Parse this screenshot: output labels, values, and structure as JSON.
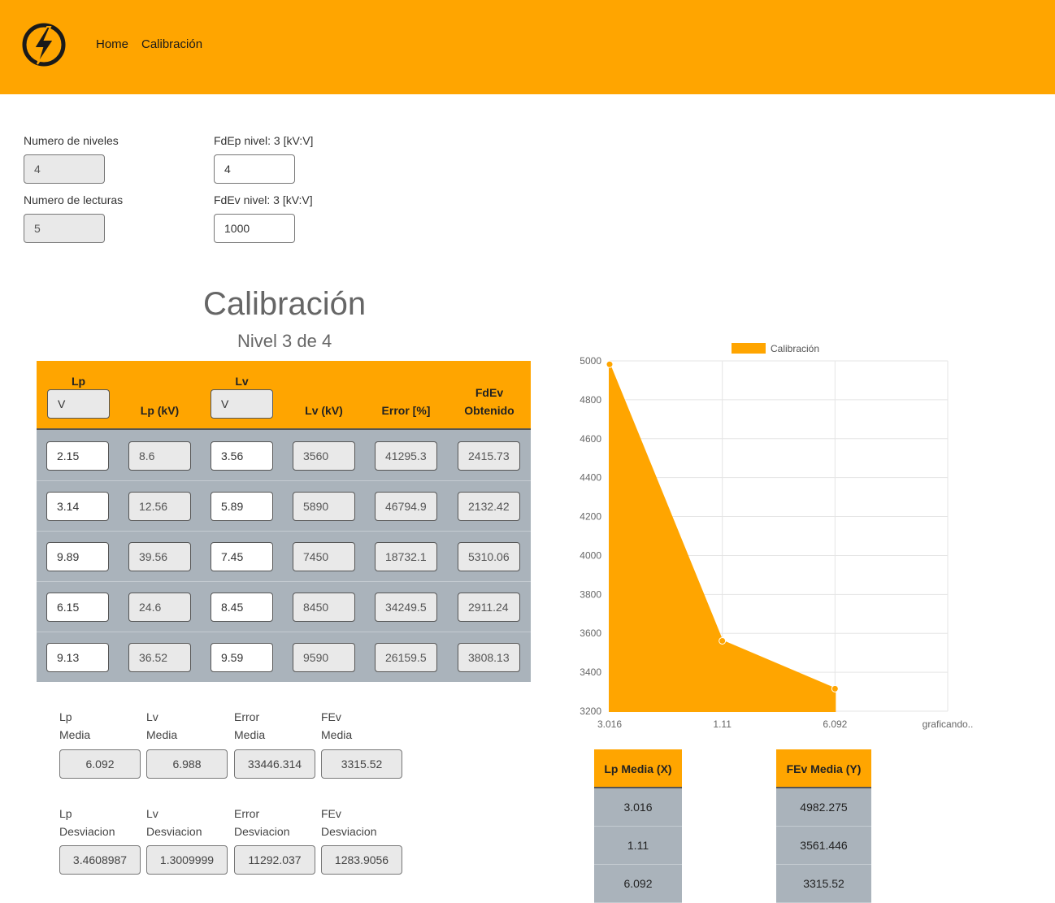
{
  "nav": {
    "home": "Home",
    "calibracion": "Calibración",
    "logo_icon": "lightning-bolt-icon"
  },
  "form": {
    "niveles_label": "Numero de niveles",
    "niveles_value": "4",
    "lecturas_label": "Numero de lecturas",
    "lecturas_value": "5",
    "fdep_label": "FdEp nivel: 3 [kV:V]",
    "fdep_value": "4",
    "fdev_label": "FdEv nivel: 3 [kV:V]",
    "fdev_value": "1000"
  },
  "section": {
    "title": "Calibración",
    "subtitle": "Nivel 3 de 4"
  },
  "table": {
    "headers": {
      "lp": "Lp",
      "lp_kv": "Lp (kV)",
      "lv": "Lv",
      "lv_kv": "Lv (kV)",
      "error": "Error [%]",
      "fdev_line1": "FdEv",
      "fdev_line2": "Obtenido"
    },
    "lp_input_value": "V",
    "lv_input_value": "V",
    "rows": [
      {
        "lp": "2.15",
        "lp_kv": "8.6",
        "lv": "3.56",
        "lv_kv": "3560",
        "error": "41295.3",
        "fdev": "2415.73"
      },
      {
        "lp": "3.14",
        "lp_kv": "12.56",
        "lv": "5.89",
        "lv_kv": "5890",
        "error": "46794.9",
        "fdev": "2132.42"
      },
      {
        "lp": "9.89",
        "lp_kv": "39.56",
        "lv": "7.45",
        "lv_kv": "7450",
        "error": "18732.1",
        "fdev": "5310.06"
      },
      {
        "lp": "6.15",
        "lp_kv": "24.6",
        "lv": "8.45",
        "lv_kv": "8450",
        "error": "34249.5",
        "fdev": "2911.24"
      },
      {
        "lp": "9.13",
        "lp_kv": "36.52",
        "lv": "9.59",
        "lv_kv": "9590",
        "error": "26159.5",
        "fdev": "3808.13"
      }
    ]
  },
  "stats": {
    "media": {
      "lp_l1": "Lp",
      "lp_l2": "Media",
      "lp_value": "6.092",
      "lv_l1": "Lv",
      "lv_l2": "Media",
      "lv_value": "6.988",
      "err_l1": "Error",
      "err_l2": "Media",
      "err_value": "33446.314",
      "fev_l1": "FEv",
      "fev_l2": "Media",
      "fev_value": "3315.52"
    },
    "desviacion": {
      "lp_l1": "Lp",
      "lp_l2": "Desviacion",
      "lp_value": "3.4608987",
      "lv_l1": "Lv",
      "lv_l2": "Desviacion",
      "lv_value": "1.3009999",
      "err_l1": "Error",
      "err_l2": "Desviacion",
      "err_value": "11292.037",
      "fev_l1": "FEv",
      "fev_l2": "Desviacion",
      "fev_value": "1283.9056"
    }
  },
  "chart_data": {
    "type": "area",
    "legend": "Calibración",
    "legend_position": "top",
    "categories": [
      "3.016",
      "1.11",
      "6.092",
      "graficando.."
    ],
    "values": [
      4982.275,
      3561.446,
      3315.52
    ],
    "ylim": [
      3200,
      5000
    ],
    "yticks": [
      "5000",
      "4800",
      "4600",
      "4400",
      "4200",
      "4000",
      "3800",
      "3600",
      "3400",
      "3200"
    ],
    "grid": true,
    "color": "#ffa500"
  },
  "media_tables": {
    "x_header": "Lp Media (X)",
    "x_values": [
      "3.016",
      "1.11",
      "6.092"
    ],
    "y_header": "FEv Media (Y)",
    "y_values": [
      "4982.275",
      "3561.446",
      "3315.52"
    ]
  }
}
